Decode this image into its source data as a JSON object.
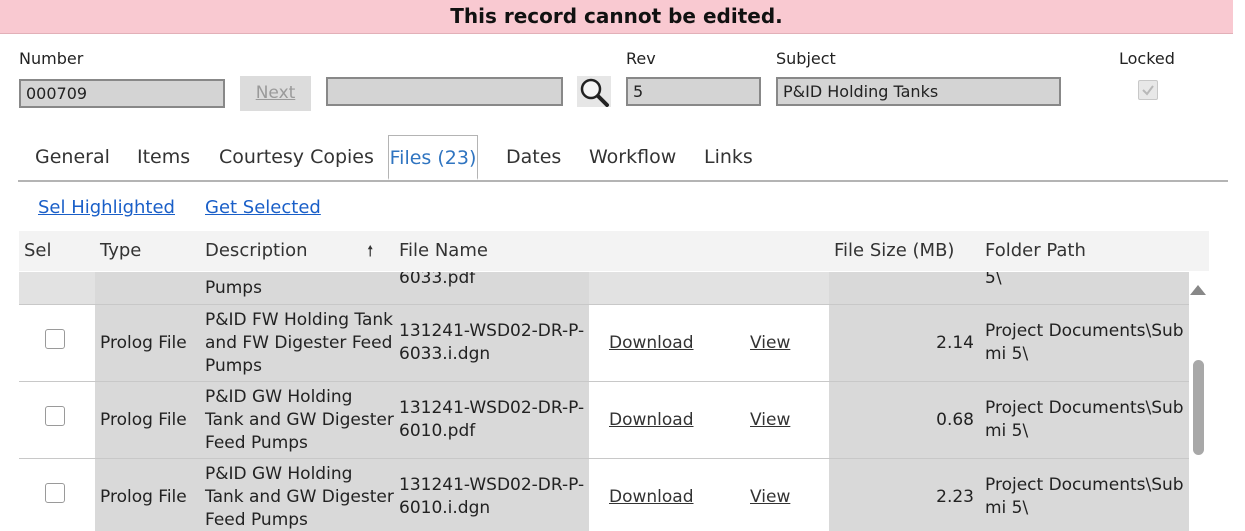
{
  "banner": {
    "message": "This record cannot be edited."
  },
  "form": {
    "number_label": "Number",
    "number_value": "000709",
    "next_label": "Next",
    "search_value": "",
    "rev_label": "Rev",
    "rev_value": "5",
    "subject_label": "Subject",
    "subject_value": "P&ID Holding Tanks",
    "locked_label": "Locked",
    "locked_checked": true
  },
  "tabs": [
    {
      "label": "General"
    },
    {
      "label": "Items"
    },
    {
      "label": "Courtesy Copies"
    },
    {
      "label": "Files (23)",
      "active": true
    },
    {
      "label": "Dates"
    },
    {
      "label": "Workflow"
    },
    {
      "label": "Links"
    }
  ],
  "actions": {
    "sel_highlighted": "Sel Highlighted",
    "get_selected": "Get Selected"
  },
  "table": {
    "headers": {
      "sel": "Sel",
      "type": "Type",
      "description": "Description",
      "sort_arrow": "🠕",
      "file_name": "File Name",
      "file_size": "File Size (MB)",
      "folder_path": "Folder Path"
    },
    "partial_row": {
      "description": "Pumps",
      "file_name": "6033.pdf",
      "folder_path": "5\\"
    },
    "rows": [
      {
        "type": "Prolog File",
        "description": "P&ID FW Holding Tank and FW Digester Feed Pumps",
        "file_name": "131241-WSD02-DR-P-6033.i.dgn",
        "download": "Download",
        "view": "View",
        "size": "2.14",
        "folder": "Project Documents\\Submi 5\\"
      },
      {
        "type": "Prolog File",
        "description": "P&ID GW Holding Tank and GW Digester Feed Pumps",
        "file_name": "131241-WSD02-DR-P-6010.pdf",
        "download": "Download",
        "view": "View",
        "size": "0.68",
        "folder": "Project Documents\\Submi 5\\"
      },
      {
        "type": "Prolog File",
        "description": "P&ID GW Holding Tank and GW Digester Feed Pumps",
        "file_name": "131241-WSD02-DR-P-6010.i.dgn",
        "download": "Download",
        "view": "View",
        "size": "2.23",
        "folder": "Project Documents\\Submi 5\\"
      }
    ]
  }
}
